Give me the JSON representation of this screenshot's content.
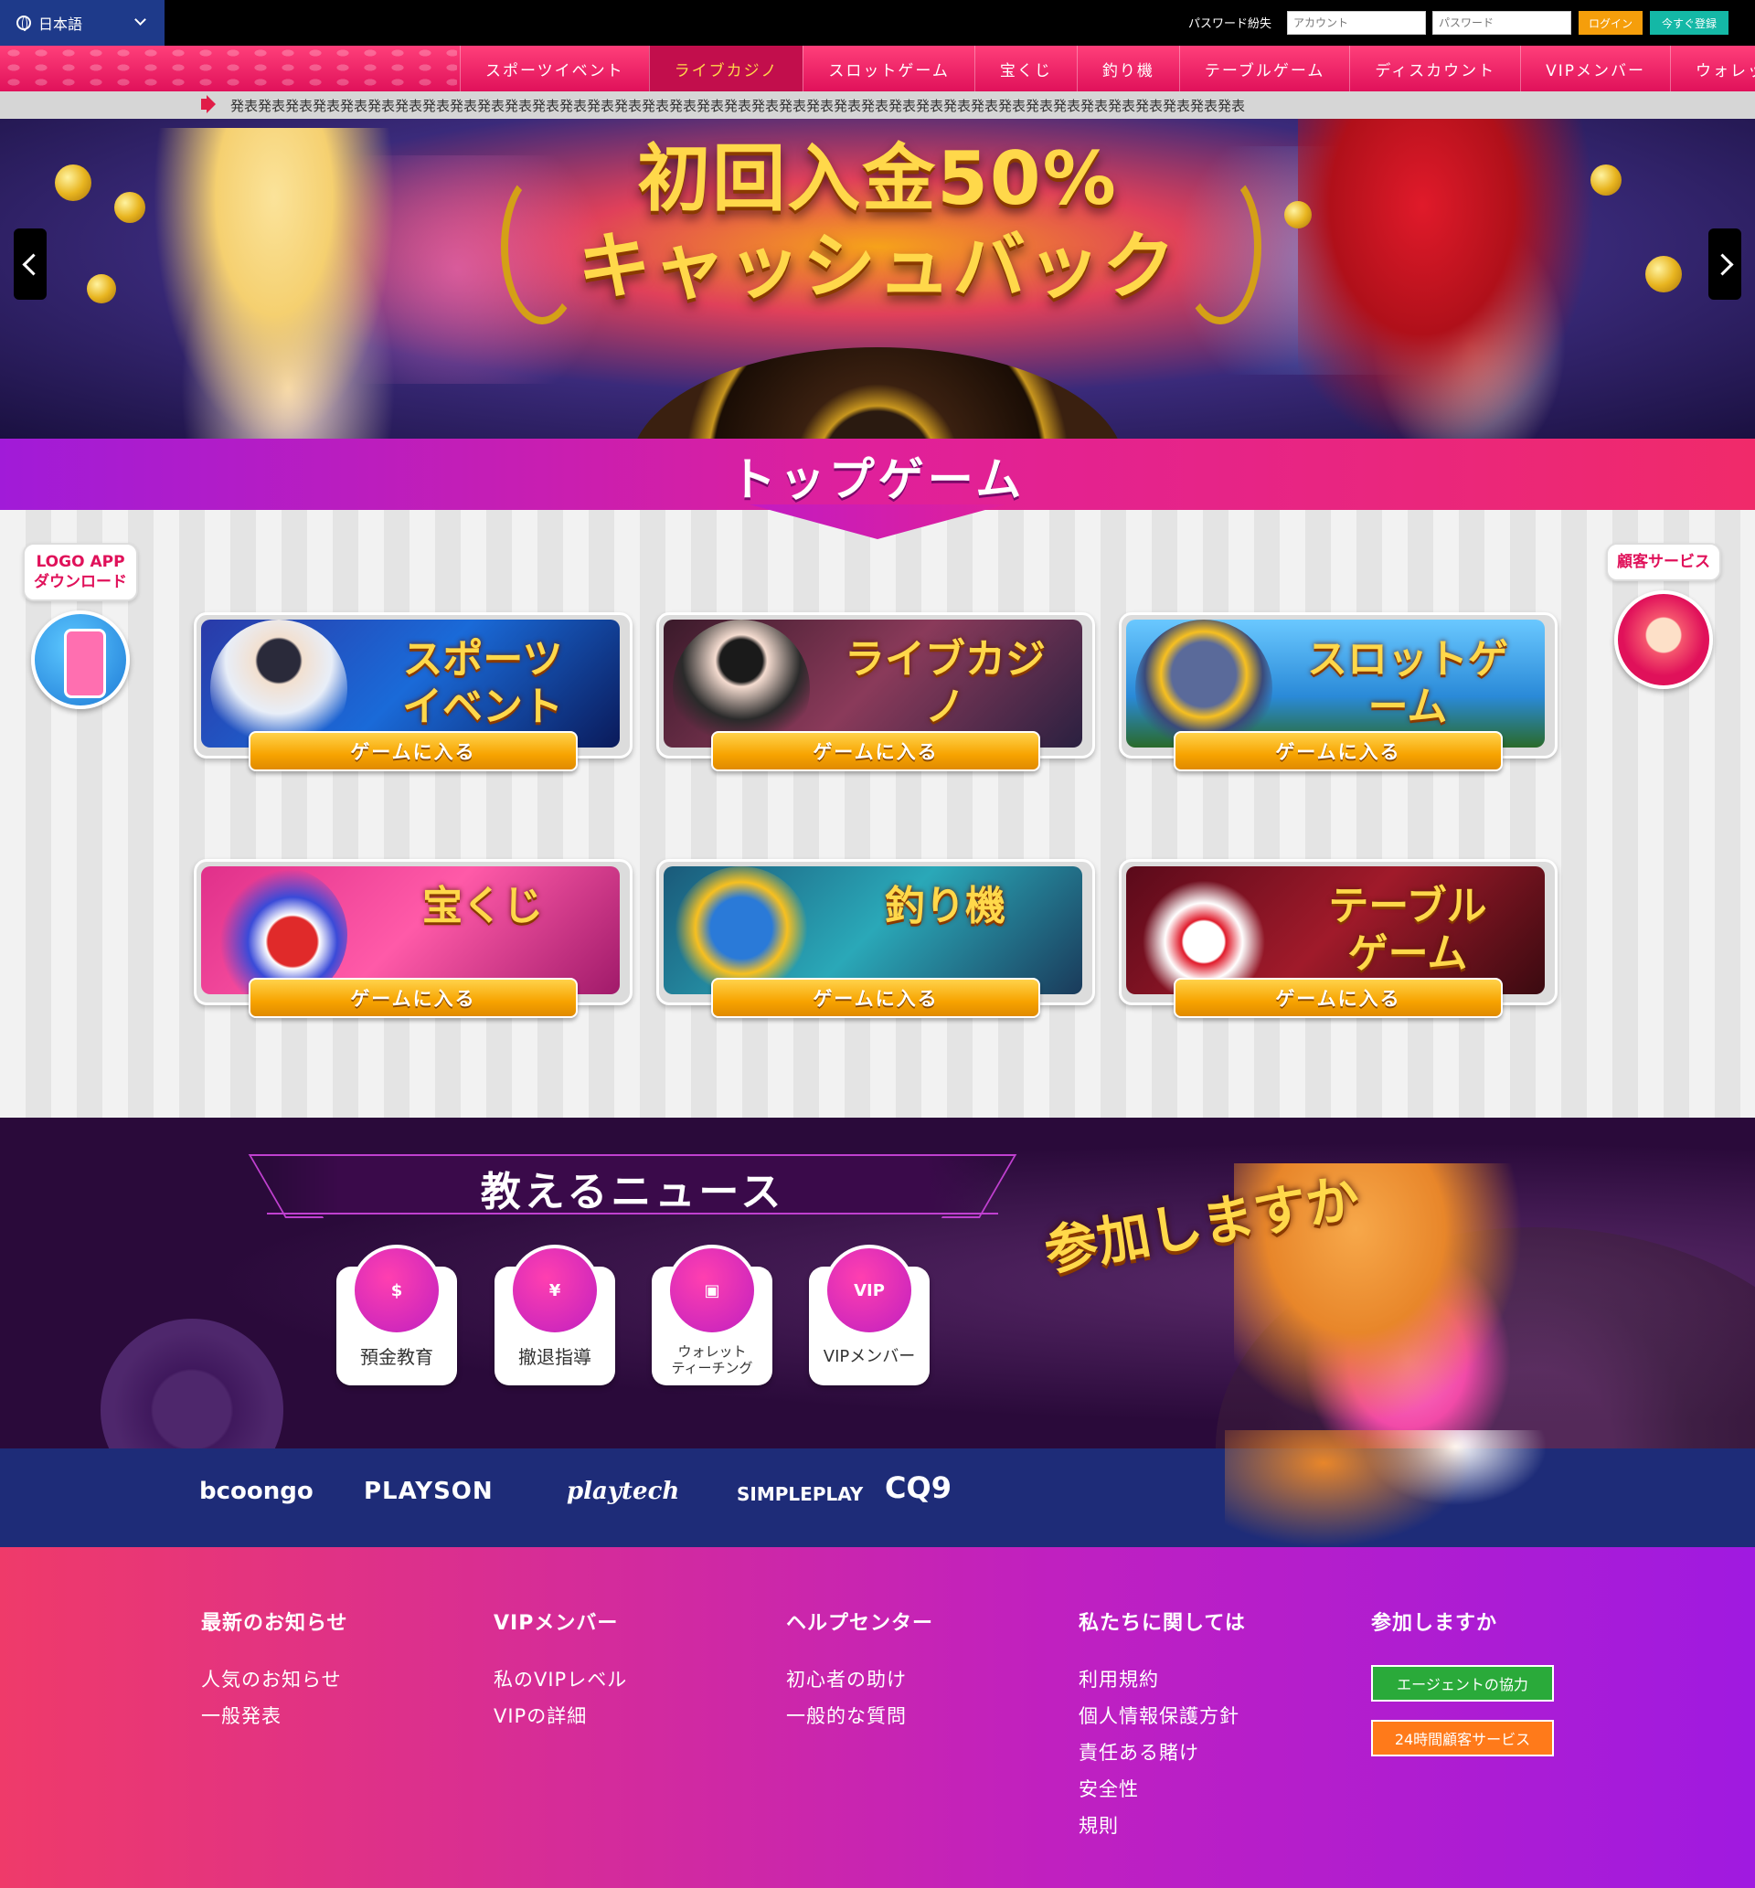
{
  "topbar": {
    "language": "日本語",
    "forgot_password": "パスワード紛失",
    "account_placeholder": "アカウント",
    "password_placeholder": "パスワード",
    "login_label": "ログイン",
    "register_label": "今すぐ登録"
  },
  "nav": {
    "items": [
      {
        "label": "スポーツイベント"
      },
      {
        "label": "ライブカジノ",
        "active": true
      },
      {
        "label": "スロットゲーム"
      },
      {
        "label": "宝くじ"
      },
      {
        "label": "釣り機"
      },
      {
        "label": "テーブルゲーム"
      },
      {
        "label": "ディスカウント"
      },
      {
        "label": "VIPメンバー"
      },
      {
        "label": "ウォレット"
      }
    ]
  },
  "ticker": {
    "text": "発表発表発表発表発表発表発表発表発表発表発表発表発表発表発表発表発表発表発表発表発表発表発表発表発表発表発表発表発表発表発表発表発表発表発表発表発表"
  },
  "hero": {
    "headline_1": "初回入金50%",
    "headline_2": "キャッシュバック"
  },
  "top_games": {
    "title": "トップゲーム",
    "app_bubble_1": "LOGO APP",
    "app_bubble_2": "ダウンロード",
    "cs_bubble": "顧客サービス",
    "enter_label": "ゲームに入る",
    "games": [
      {
        "title_1": "スポーツ",
        "title_2": "イベント"
      },
      {
        "title_1": "ライブカジノ",
        "title_2": ""
      },
      {
        "title_1": "スロットゲーム",
        "title_2": ""
      },
      {
        "title_1": "宝くじ",
        "title_2": ""
      },
      {
        "title_1": "釣り機",
        "title_2": ""
      },
      {
        "title_1": "テーブル",
        "title_2": "ゲーム"
      }
    ]
  },
  "news": {
    "title": "教えるニュース",
    "join_text": "参加しますか",
    "cards": [
      {
        "label": "預金教育",
        "icon": "piggy-bank-icon"
      },
      {
        "label": "撤退指導",
        "icon": "money-withdraw-icon"
      },
      {
        "label": "ウォレット",
        "label_2": "ティーチング",
        "icon": "wallet-icon"
      },
      {
        "label": "VIPメンバー",
        "icon": "vip-crown-icon",
        "icon_text": "VIP"
      }
    ]
  },
  "providers": [
    "bcoongo",
    "PLAYSON",
    "playtech",
    "SIMPLEPLAY",
    "CQ9"
  ],
  "footer": {
    "columns": [
      {
        "heading": "最新のお知らせ",
        "links": [
          "人気のお知らせ",
          "一般発表"
        ]
      },
      {
        "heading": "VIPメンバー",
        "links": [
          "私のVIPレベル",
          "VIPの詳細"
        ]
      },
      {
        "heading": "ヘルプセンター",
        "links": [
          "初心者の助け",
          "一般的な質問"
        ]
      },
      {
        "heading": "私たちに関しては",
        "links": [
          "利用規約",
          "個人情報保護方針",
          "責任ある賭け",
          "安全性",
          "規則"
        ]
      },
      {
        "heading": "参加しますか",
        "buttons": [
          "エージェントの協力",
          "24時間顧客サービス"
        ]
      }
    ]
  }
}
